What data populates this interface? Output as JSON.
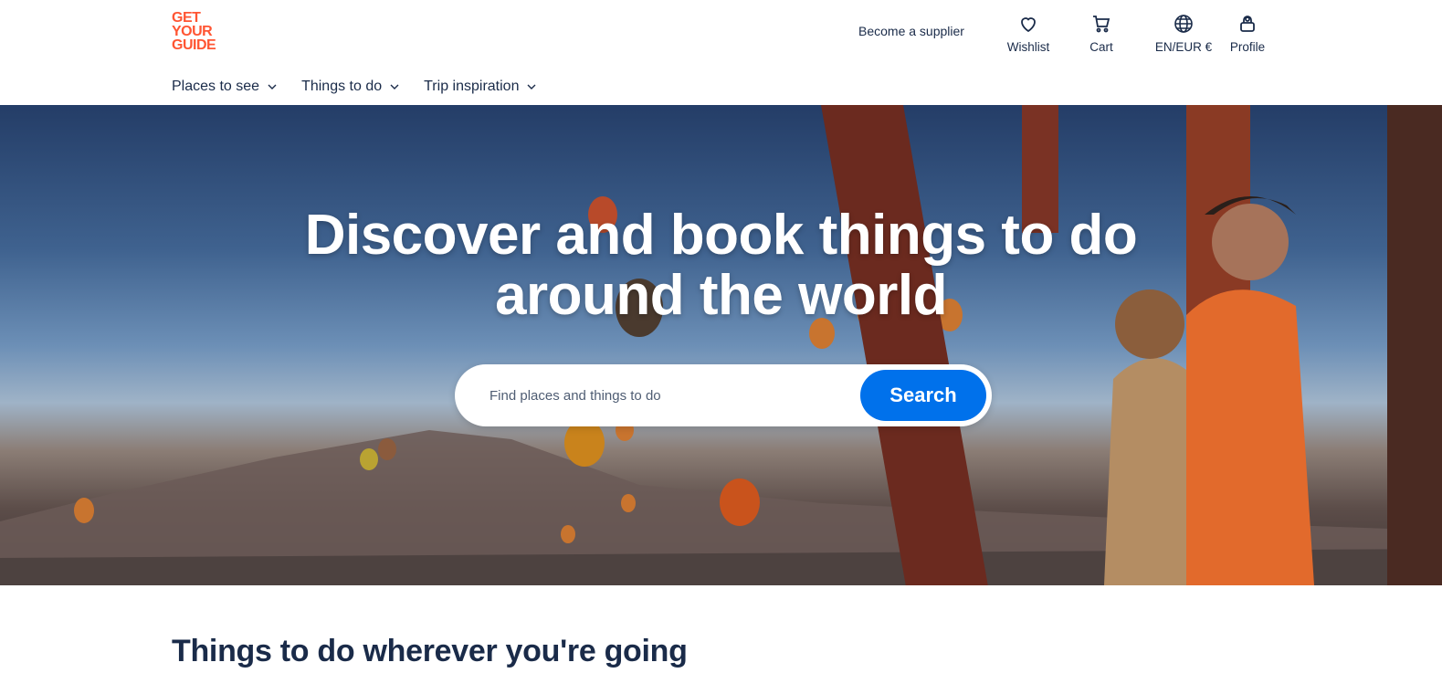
{
  "logo": {
    "line1": "GET",
    "line2": "YOUR",
    "line3": "GUIDE"
  },
  "header": {
    "supplier_link": "Become a supplier",
    "actions": [
      {
        "label": "Wishlist",
        "icon": "heart-icon"
      },
      {
        "label": "Cart",
        "icon": "cart-icon"
      },
      {
        "label": "EN/EUR €",
        "icon": "globe-icon"
      },
      {
        "label": "Profile",
        "icon": "profile-icon"
      }
    ]
  },
  "nav": {
    "items": [
      {
        "label": "Places to see"
      },
      {
        "label": "Things to do"
      },
      {
        "label": "Trip inspiration"
      }
    ]
  },
  "hero": {
    "title_line1": "Discover and book things to do",
    "title_line2": "around the world",
    "search_placeholder": "Find places and things to do",
    "search_button": "Search"
  },
  "section": {
    "title": "Things to do wherever you're going"
  },
  "colors": {
    "brand": "#ff5533",
    "primary": "#0071eb",
    "text": "#1a2b49"
  }
}
